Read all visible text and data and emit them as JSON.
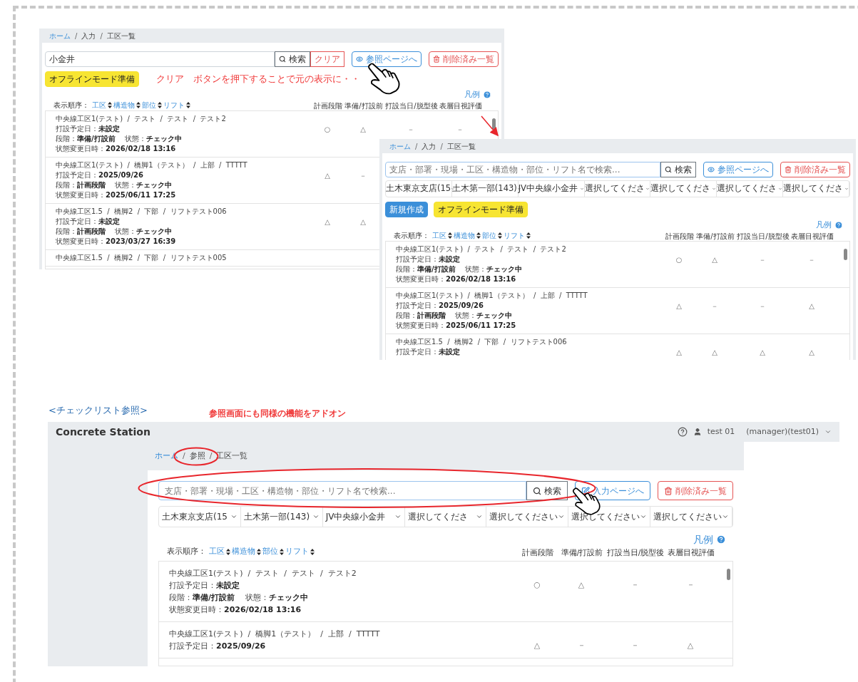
{
  "section_title": "<チェックリスト参照>",
  "section_note": "参照画面にも同様の機能をアドオン",
  "screens": [
    {
      "breadcrumb": {
        "separator": "/",
        "items": [
          {
            "label": "ホーム",
            "link": true
          },
          {
            "label": "入力",
            "link": false
          },
          {
            "label": "工区一覧",
            "link": false
          }
        ]
      },
      "search": {
        "value": "小金井"
      },
      "search_buttons": [
        {
          "label": "検索",
          "kind": "search"
        },
        {
          "label": "クリア",
          "kind": "clear"
        }
      ],
      "nav_buttons": [
        {
          "label": "参照ページへ",
          "kind": "view"
        },
        {
          "label": "削除済み一覧",
          "kind": "deleted"
        }
      ],
      "action_buttons": [
        {
          "label": "オフラインモード準備",
          "kind": "offline"
        }
      ],
      "note": "クリア　ボタンを押下することで元の表示に・・",
      "legend": "凡例",
      "sort_label": "表示順序：",
      "sort_keys": [
        "工区",
        "構造物",
        "部位",
        "リフト"
      ],
      "columns": [
        "計画段階",
        "準備/打設前",
        "打設当日/脱型後",
        "表層目視評価"
      ],
      "rows": [
        {
          "title": "中央線工区1(テスト)  /  テスト  /  テスト  /  テスト2",
          "lines": [
            "打設予定日：**未設定**",
            "段階：**準備/打設前**　 状態：**チェック中**",
            "状態変更日時：**2026/02/18 13:16**"
          ],
          "marks": [
            "○",
            "△",
            "－",
            "－"
          ]
        },
        {
          "title": "中央線工区1(テスト)  /  橋脚1（テスト）  /  上部  /  TTTTT",
          "lines": [
            "打設予定日：**2025/09/26**",
            "段階：**計画段階**　 状態：**チェック中**",
            "状態変更日時：**2025/06/11 17:25**"
          ],
          "marks": [
            "△",
            "－"
          ]
        },
        {
          "title": "中央線工区1.5  /  橋脚2  /  下部  /  リフトテスト006",
          "lines": [
            "打設予定日：**未設定**",
            "段階：**計画段階**　 状態：**チェック中**",
            "状態変更日時：**2023/03/27 16:39**"
          ],
          "marks": [
            "△",
            "△"
          ]
        },
        {
          "title": "中央線工区1.5  /  橋脚2  /  下部  /  リフトテスト005",
          "lines": [],
          "marks": []
        }
      ]
    },
    {
      "breadcrumb": {
        "separator": "/",
        "items": [
          {
            "label": "ホーム",
            "link": true
          },
          {
            "label": "入力",
            "link": false
          },
          {
            "label": "工区一覧",
            "link": false
          }
        ]
      },
      "search": {
        "placeholder": "支店・部署・現場・工区・構造物・部位・リフト名で検索..."
      },
      "search_buttons": [
        {
          "label": "検索",
          "kind": "search"
        }
      ],
      "nav_buttons": [
        {
          "label": "参照ページへ",
          "kind": "view"
        },
        {
          "label": "削除済み一覧",
          "kind": "deleted"
        }
      ],
      "filters": [
        "土木東京支店(15",
        "土木第一部(143)",
        "JV中央線小金井",
        "選択してくださ",
        "選択してくださ",
        "選択してくださ",
        "選択してくださ"
      ],
      "action_buttons": [
        {
          "label": "新規作成",
          "kind": "new"
        },
        {
          "label": "オフラインモード準備",
          "kind": "offline"
        }
      ],
      "legend": "凡例",
      "sort_label": "表示順序：",
      "sort_keys": [
        "工区",
        "構造物",
        "部位",
        "リフト"
      ],
      "columns": [
        "計画段階",
        "準備/打設前",
        "打設当日/脱型後",
        "表層目視評価"
      ],
      "rows": [
        {
          "title": "中央線工区1(テスト)  /  テスト  /  テスト  /  テスト2",
          "lines": [
            "打設予定日：**未設定**",
            "段階：**準備/打設前**　 状態：**チェック中**",
            "状態変更日時：**2026/02/18 13:16**"
          ],
          "marks": [
            "○",
            "△",
            "－",
            "－"
          ]
        },
        {
          "title": "中央線工区1(テスト)  /  橋脚1（テスト）  /  上部  /  TTTTT",
          "lines": [
            "打設予定日：**2025/09/26**",
            "段階：**計画段階**　 状態：**チェック中**",
            "状態変更日時：**2025/06/11 17:25**"
          ],
          "marks": [
            "△",
            "－",
            "－",
            "△"
          ]
        },
        {
          "title": "中央線工区1.5  /  橋脚2  /  下部  /  リフトテスト006",
          "lines": [
            "打設予定日：**未設定**"
          ],
          "marks": [
            "△",
            "△",
            "△",
            "△"
          ]
        }
      ]
    },
    {
      "app_header": {
        "title": "Concrete Station",
        "user": "test 01",
        "role": "(manager)(test01)"
      },
      "breadcrumb": {
        "separator": "/",
        "items": [
          {
            "label": "ホーム",
            "link": true
          },
          {
            "label": "参照",
            "link": false
          },
          {
            "label": "工区一覧",
            "link": false
          }
        ]
      },
      "search": {
        "placeholder": "支店・部署・現場・工区・構造物・部位・リフト名で検索..."
      },
      "search_buttons": [
        {
          "label": "検索",
          "kind": "search"
        }
      ],
      "nav_buttons": [
        {
          "label": "入力ページへ",
          "kind": "edit"
        },
        {
          "label": "削除済み一覧",
          "kind": "deleted"
        }
      ],
      "filters": [
        "土木東京支店(15",
        "土木第一部(143)",
        "JV中央線小金井",
        "選択してくださ",
        "選択してください",
        "選択してください",
        "選択してください"
      ],
      "legend": "凡例",
      "sort_label": "表示順序：",
      "sort_keys": [
        "工区",
        "構造物",
        "部位",
        "リフト"
      ],
      "columns": [
        "計画段階",
        "準備/打設前",
        "打設当日/脱型後",
        "表層目視評価"
      ],
      "rows": [
        {
          "title": "中央線工区1(テスト)  /  テスト  /  テスト  /  テスト2",
          "lines": [
            "打設予定日：**未設定**",
            "段階：**準備/打設前**　 状態：**チェック中**",
            "状態変更日時：**2026/02/18 13:16**"
          ],
          "marks": [
            "○",
            "△",
            "－",
            "－"
          ]
        },
        {
          "title": "中央線工区1(テスト)  /  橋脚1（テスト）  /  上部  /  TTTTT",
          "lines": [
            "打設予定日：**2025/09/26**"
          ],
          "marks": [
            "△",
            "－",
            "－",
            "△"
          ]
        }
      ]
    }
  ]
}
